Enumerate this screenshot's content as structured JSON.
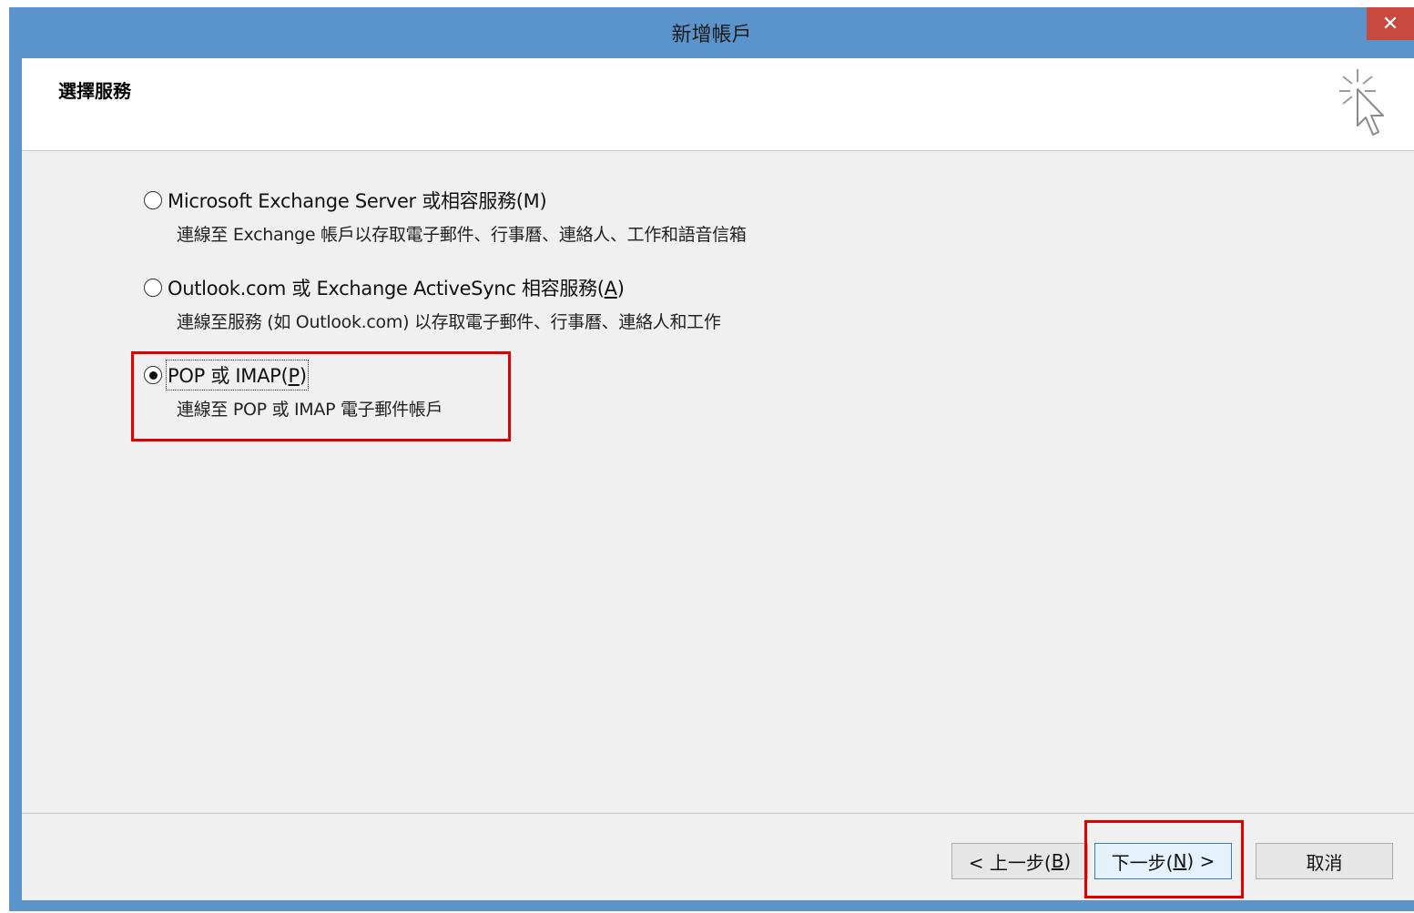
{
  "window": {
    "title": "新增帳戶",
    "close_glyph": "✕"
  },
  "header": {
    "title": "選擇服務",
    "icon": "wizard-cursor-icon"
  },
  "options": [
    {
      "label_pre": "Microsoft Exchange Server 或相容服務(M)",
      "description": "連線至 Exchange 帳戶以存取電子郵件、行事曆、連絡人、工作和語音信箱",
      "checked": false
    },
    {
      "label_pre": "Outlook.com 或 Exchange ActiveSync 相容服務(",
      "label_key": "A",
      "label_post": ")",
      "description": "連線至服務 (如 Outlook.com) 以存取電子郵件、行事曆、連絡人和工作",
      "checked": false
    },
    {
      "label_pre": "POP 或 IMAP(",
      "label_key": "P",
      "label_post": ")",
      "description": "連線至 POP 或 IMAP 電子郵件帳戶",
      "checked": true
    }
  ],
  "buttons": {
    "back_pre": "< 上一步(",
    "back_key": "B",
    "back_post": ")",
    "next_pre": "下一步(",
    "next_key": "N",
    "next_post": ") >",
    "cancel": "取消"
  },
  "colors": {
    "title_bar": "#5b93cb",
    "close_button": "#c84a3f",
    "highlight": "#e00000",
    "client_bg": "#f0f0f0"
  }
}
